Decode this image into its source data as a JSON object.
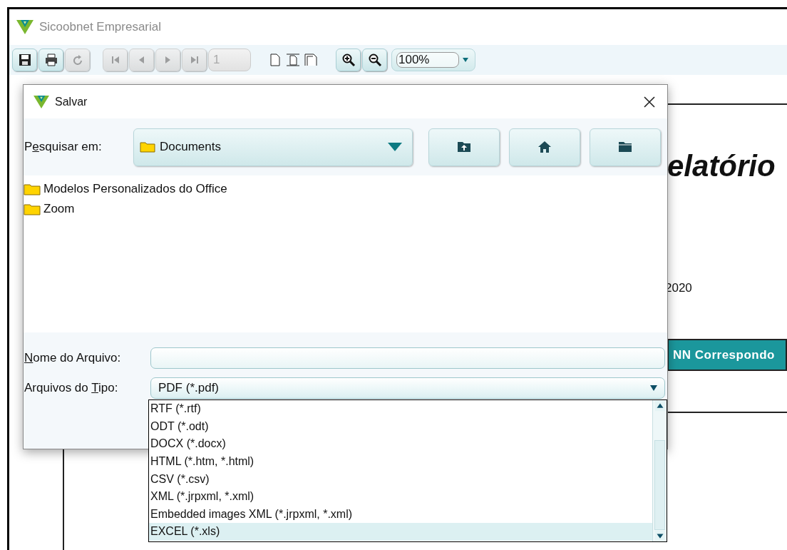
{
  "window": {
    "title": "Sicoobnet Empresarial"
  },
  "toolbar": [
    {
      "kind": "save",
      "disabled": false
    },
    {
      "kind": "print",
      "disabled": false
    },
    {
      "kind": "refresh",
      "disabled": true
    },
    {
      "kind": "first",
      "disabled": true
    },
    {
      "kind": "prev",
      "disabled": true
    },
    {
      "kind": "next",
      "disabled": true
    },
    {
      "kind": "last",
      "disabled": true
    },
    {
      "kind": "page_field",
      "value": "1",
      "disabled": true
    },
    {
      "kind": "page_single"
    },
    {
      "kind": "page_width"
    },
    {
      "kind": "page_full"
    },
    {
      "kind": "zoom_in",
      "disabled": false
    },
    {
      "kind": "zoom_out",
      "disabled": false
    },
    {
      "kind": "zoom_combo",
      "value": "100%"
    }
  ],
  "report": {
    "title_fragment": "elatório",
    "date_fragment": "2020",
    "header_fragment": "NN Correspondo"
  },
  "dialog": {
    "title": "Salvar",
    "look_in": {
      "label": {
        "before": "P",
        "key": "e",
        "after": "squisar em:"
      },
      "value": "Documents"
    },
    "buttons": [
      {
        "kind": "up_folder"
      },
      {
        "kind": "home"
      },
      {
        "kind": "new_folder"
      }
    ],
    "files": [
      {
        "name": "Modelos Personalizados do Office",
        "selected": false
      },
      {
        "name": "Zoom",
        "selected": false
      }
    ],
    "file_name": {
      "label": {
        "key": "N",
        "after": "ome do Arquivo:"
      }
    },
    "file_type": {
      "label": {
        "before": "Arquivos do ",
        "key": "T",
        "after": "ipo:"
      },
      "value": "PDF (*.pdf)",
      "expanded": true,
      "options": [
        {
          "label": "RTF (*.rtf)",
          "selected": false
        },
        {
          "label": "ODT (*.odt)",
          "selected": false
        },
        {
          "label": "DOCX (*.docx)",
          "selected": false
        },
        {
          "label": "HTML (*.htm, *.html)",
          "selected": false
        },
        {
          "label": "CSV (*.csv)",
          "selected": false
        },
        {
          "label": "XML (*.jrpxml, *.xml)",
          "selected": false
        },
        {
          "label": "Embedded images XML (*.jrpxml, *.xml)",
          "selected": false
        },
        {
          "label": "EXCEL (*.xls)",
          "selected": true
        }
      ]
    }
  }
}
